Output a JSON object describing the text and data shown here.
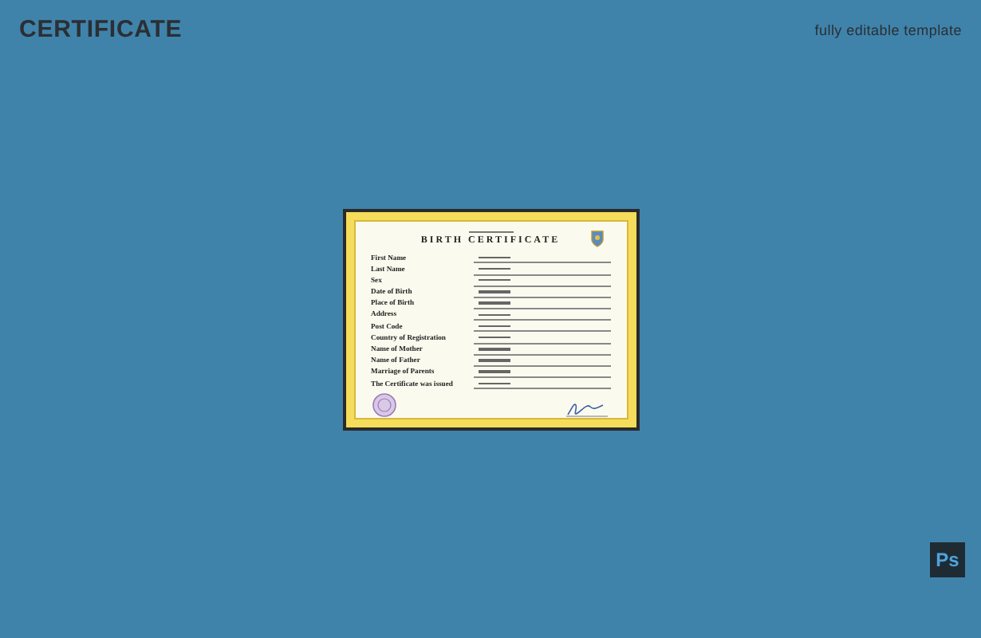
{
  "header": {
    "title": "CERTIFICATE",
    "tagline": "fully editable template"
  },
  "certificate": {
    "title": "BIRTH CERTIFICATE",
    "fields": [
      {
        "label": "First Name"
      },
      {
        "label": "Last Name"
      },
      {
        "label": "Sex"
      },
      {
        "label": "Date of Birth"
      },
      {
        "label": "Place of Birth"
      },
      {
        "label": "Address"
      },
      {
        "label": "Post Code"
      },
      {
        "label": "Country of Registration"
      },
      {
        "label": "Name of Mother"
      },
      {
        "label": "Name of Father"
      },
      {
        "label": "Marriage of Parents"
      },
      {
        "label": "The Certificate was issued"
      }
    ]
  },
  "app_badge": {
    "text": "Ps"
  }
}
